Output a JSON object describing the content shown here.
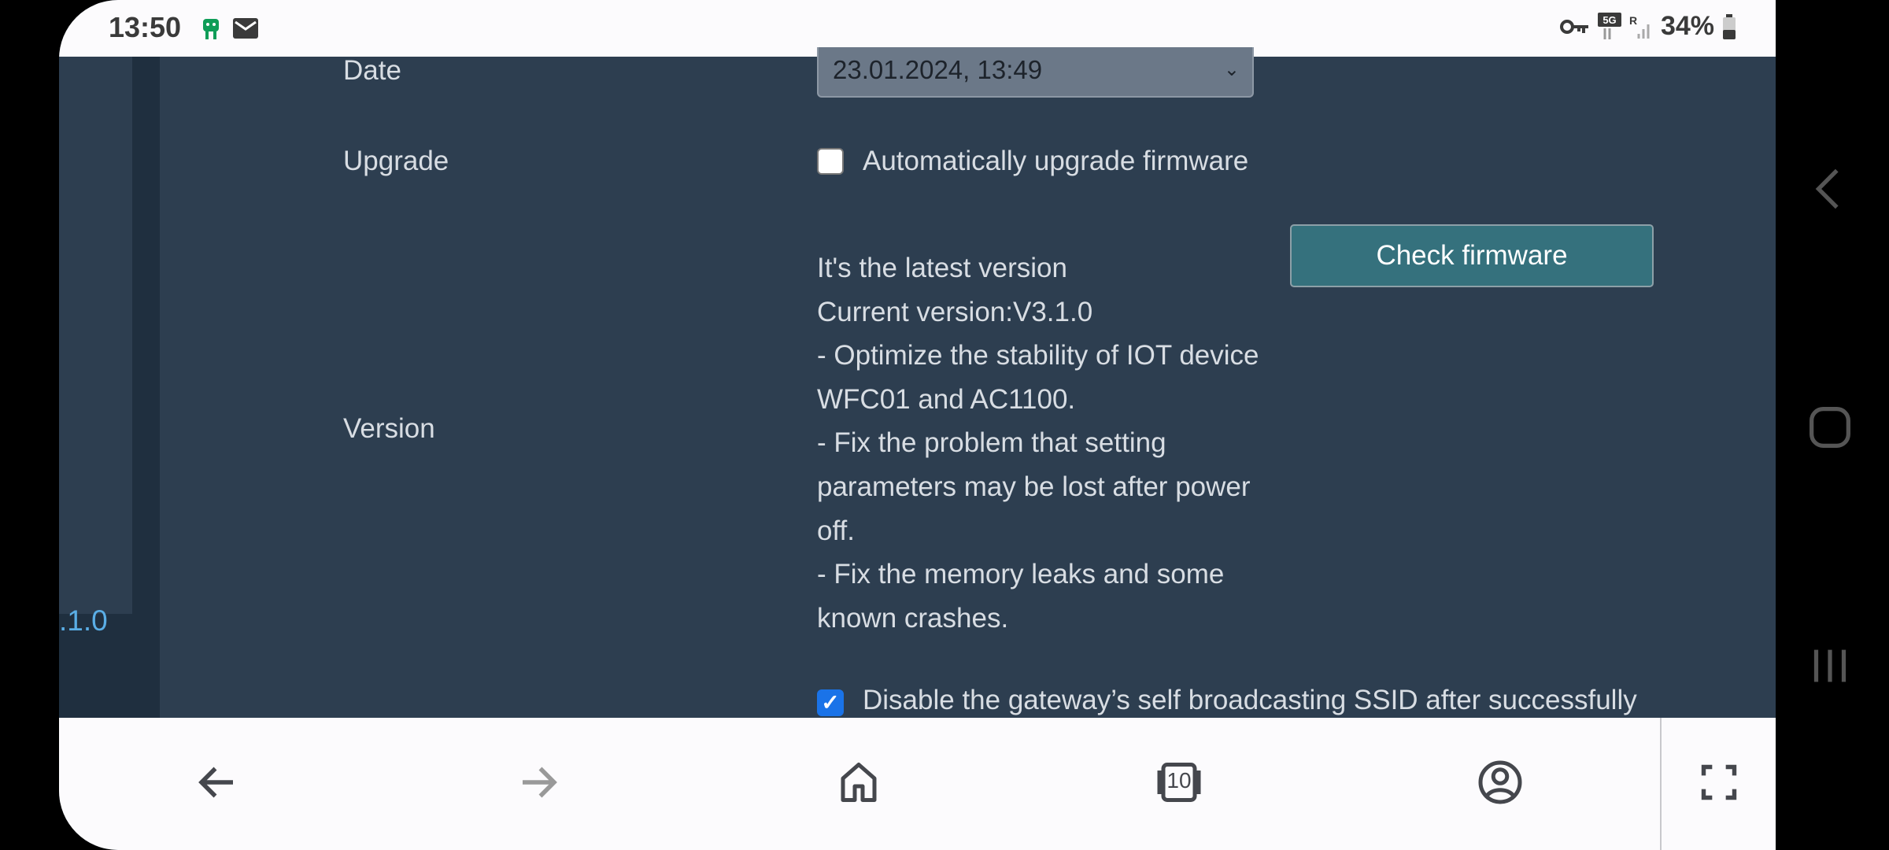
{
  "status_bar": {
    "time": "13:50",
    "battery": "34%",
    "notification_icons": [
      "app-icon",
      "mail-icon"
    ],
    "system_icons": [
      "vpn-key-icon",
      "5g-icon",
      "signal-icon",
      "battery-icon"
    ]
  },
  "sidebar": {
    "version_fragment": ".1.0"
  },
  "form": {
    "date_label": "Date",
    "date_value": "23.01.2024, 13:49",
    "upgrade_label": "Upgrade",
    "auto_upgrade_label": "Automatically upgrade firmware",
    "auto_upgrade_checked": false,
    "version_label": "Version",
    "version_lines": [
      "It's the latest version",
      "Current version:V3.1.0",
      "- Optimize the stability of IOT device",
      "WFC01 and AC1100.",
      "- Fix the problem that setting",
      "parameters may be lost after power",
      "off.",
      "- Fix the memory leaks and some",
      "known crashes."
    ],
    "check_firmware_label": "Check firmware",
    "disable_ssid_label": "Disable the gateway’s self broadcasting SSID after successfully",
    "disable_ssid_checked": true
  },
  "browser_bar": {
    "tab_count": "10"
  },
  "colors": {
    "page_bg": "#2d3e50",
    "button": "#35717d",
    "accent_link": "#5aaee6",
    "checkbox": "#1a73e8"
  }
}
